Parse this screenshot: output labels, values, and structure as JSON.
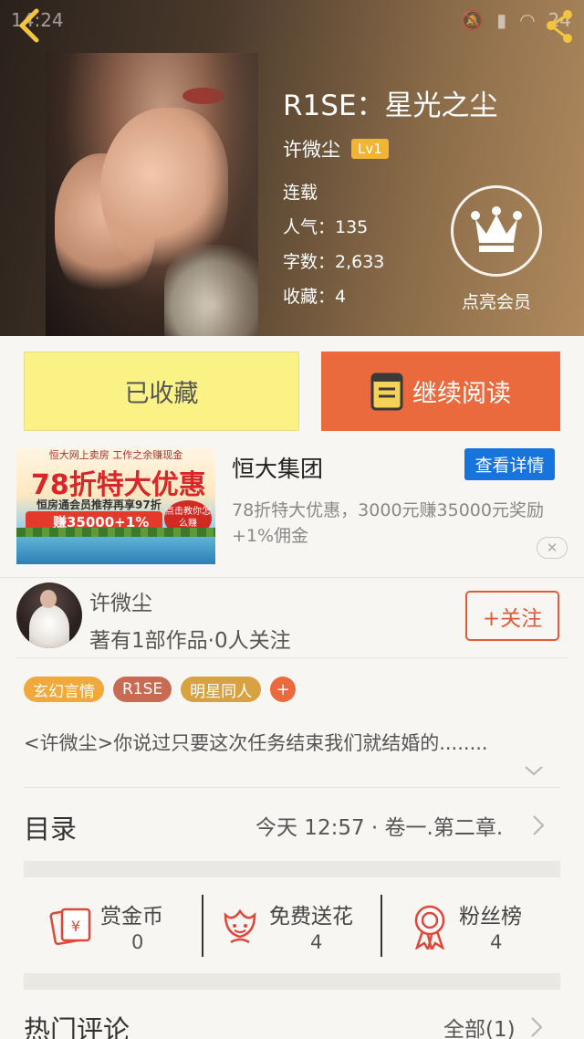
{
  "status_bar": {
    "time": "14:24",
    "battery": "24"
  },
  "book": {
    "title": "R1SE：星光之尘",
    "author": "许微尘",
    "level": "Lv1",
    "status": "连载",
    "popularity": "人气：135",
    "word_count": "字数：2,633",
    "favorites": "收藏：4"
  },
  "vip": {
    "label": "点亮会员"
  },
  "actions": {
    "favorited_label": "已收藏",
    "continue_label": "继续阅读"
  },
  "ad": {
    "banner_top": "恒大网上卖房 工作之余赚现金",
    "banner_main": "78折特大优惠",
    "banner_sub": "恒房通会员推荐再享97折",
    "banner_strip": "赚35000+1%",
    "banner_circle": "点击教你怎么赚",
    "title": "恒大集团",
    "detail_label": "查看详情",
    "description": "78折特大优惠，3000元赚35000元奖励+1%佣金",
    "close_label": "✕"
  },
  "author_card": {
    "name": "许微尘",
    "info": "著有1部作品·0人关注",
    "follow_label": "+关注"
  },
  "tags": [
    {
      "label": "玄幻言情",
      "color": "#f2a93b"
    },
    {
      "label": "R1SE",
      "color": "#c96a53"
    },
    {
      "label": "明星同人",
      "color": "#d8a243"
    }
  ],
  "synopsis": "<许微尘>你说过只要这次任务结束我们就结婚的........",
  "toc": {
    "title": "目录",
    "latest": "今天 12:57 · 卷一.第二章."
  },
  "stats": [
    {
      "label": "赏金币",
      "value": "0",
      "icon": "red-envelope-icon"
    },
    {
      "label": "免费送花",
      "value": "4",
      "icon": "flower-icon"
    },
    {
      "label": "粉丝榜",
      "value": "4",
      "icon": "medal-icon"
    }
  ],
  "comments": {
    "title": "热门评论",
    "all_label": "全部(1)"
  },
  "colors": {
    "accent": "#ea6a3e",
    "favorite_bg": "#fbf285",
    "ad_button": "#1774dd"
  }
}
